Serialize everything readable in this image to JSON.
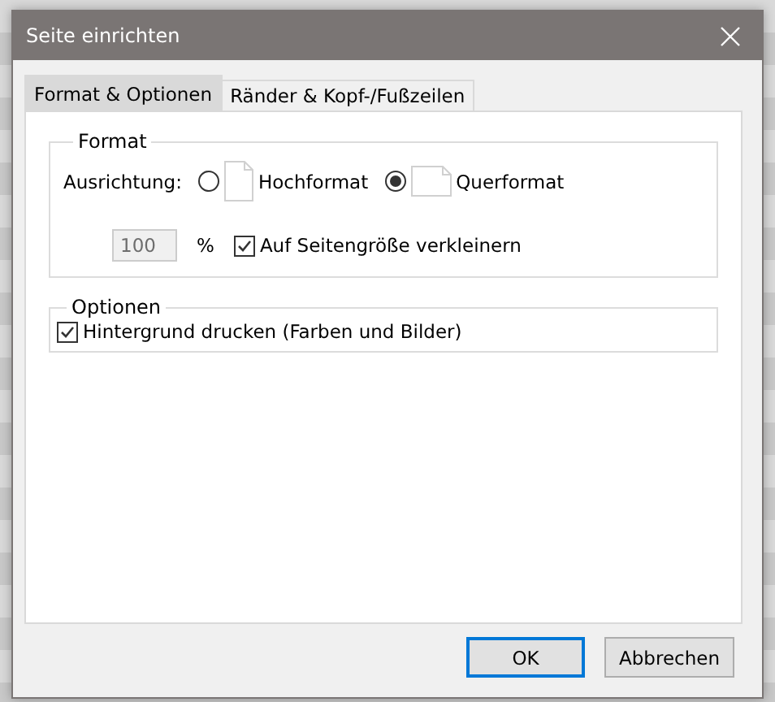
{
  "window": {
    "title": "Seite einrichten"
  },
  "tabs": [
    {
      "label": "Format & Optionen",
      "selected": true
    },
    {
      "label": "Ränder & Kopf-/Fußzeilen",
      "selected": false
    }
  ],
  "format": {
    "title": "Format",
    "orientation_label": "Ausrichtung:",
    "orientations": [
      {
        "label": "Hochformat",
        "kind": "portrait",
        "selected": false
      },
      {
        "label": "Querformat",
        "kind": "landscape",
        "selected": true
      }
    ],
    "scale": {
      "value": "100",
      "disabled": true
    },
    "unit": "%",
    "shrink": {
      "label": "Auf Seitengröße verkleinern",
      "checked": true
    }
  },
  "options": {
    "title": "Optionen",
    "items": [
      {
        "label": "Hintergrund drucken (Farben und Bilder)",
        "checked": true
      }
    ]
  },
  "buttons": [
    {
      "label": "OK",
      "default": true
    },
    {
      "label": "Abbrechen",
      "default": false
    }
  ]
}
